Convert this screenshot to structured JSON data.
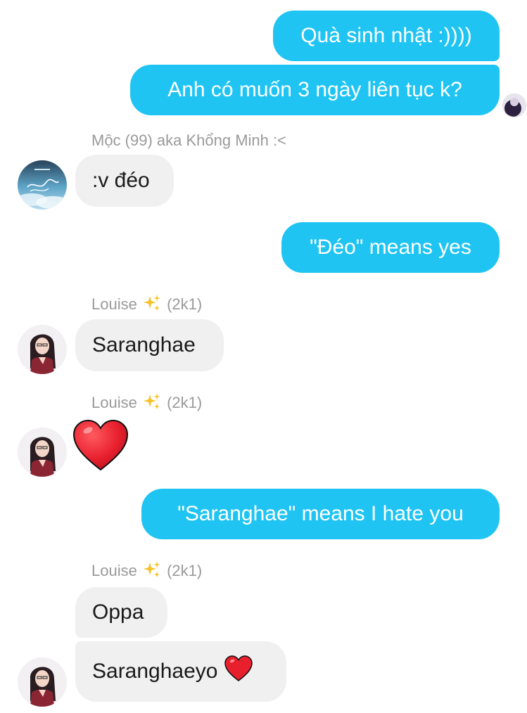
{
  "messages": {
    "m1": "Quà sinh nhật :))))",
    "m2": "Anh có muốn 3 ngày liên tục k?",
    "m3": ":v đéo",
    "m4": "\"Đéo\" means yes",
    "m5": "Saranghae",
    "m6": "\"Saranghae\" means I hate you",
    "m7": "Oppa",
    "m8": "Saranghaeyo"
  },
  "senders": {
    "moc": "Mộc (99) aka Khổng Minh :<",
    "louise_name": "Louise",
    "louise_suffix": "(2k1)"
  },
  "icons": {
    "heart": "red-heart-emoji",
    "sparkles": "sparkles-emoji"
  },
  "colors": {
    "outgoing_bubble": "#1fc4f3",
    "incoming_bubble": "#f0f0f0",
    "heart": "#e8202e"
  }
}
